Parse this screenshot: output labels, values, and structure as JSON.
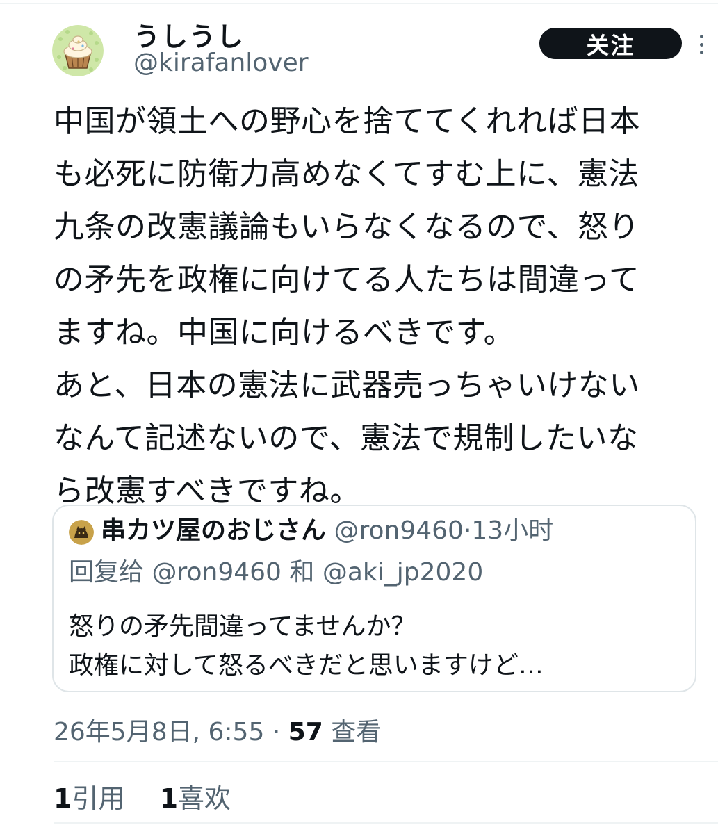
{
  "author": {
    "display_name": "うしうし",
    "handle": "@kirafanlover",
    "avatar_icon": "cupcake-avatar-icon"
  },
  "follow_button": {
    "label": "关注"
  },
  "more_button": {
    "icon": "more-vertical-icon"
  },
  "tweet": {
    "text": "中国が領土への野心を捨ててくれれば日本\nも必死に防衛力高めなくてすむ上に、憲法\n九条の改憲議論もいらなくなるので、怒り\nの矛先を政権に向けてる人たちは間違って\nますね。中国に向けるべきです。\nあと、日本の憲法に武器売っちゃいけない\nなんて記述ないので、憲法で規制したいな\nら改憲すべきですね。"
  },
  "quote": {
    "display_name": "串カツ屋のおじさん",
    "handle": "@ron9460",
    "separator": "·",
    "time": "13小时",
    "reply_prefix": "回复给",
    "reply_user_1": "@ron9460",
    "reply_and": "和",
    "reply_user_2": "@aki_jp2020",
    "text": "怒りの矛先間違ってませんか？\n政権に対して怒るべきだと思いますけど…",
    "avatar_icon": "cat-avatar-icon"
  },
  "meta": {
    "date": "26年5月8日, 6:55",
    "separator": "·",
    "views_count": "57",
    "views_label": "查看"
  },
  "stats": {
    "quotes_count": "1",
    "quotes_label": "引用",
    "likes_count": "1",
    "likes_label": "喜欢"
  },
  "colors": {
    "text_primary": "#0f1419",
    "text_secondary": "#536471",
    "border": "#dfe5e8",
    "button_bg": "#0f1419"
  }
}
